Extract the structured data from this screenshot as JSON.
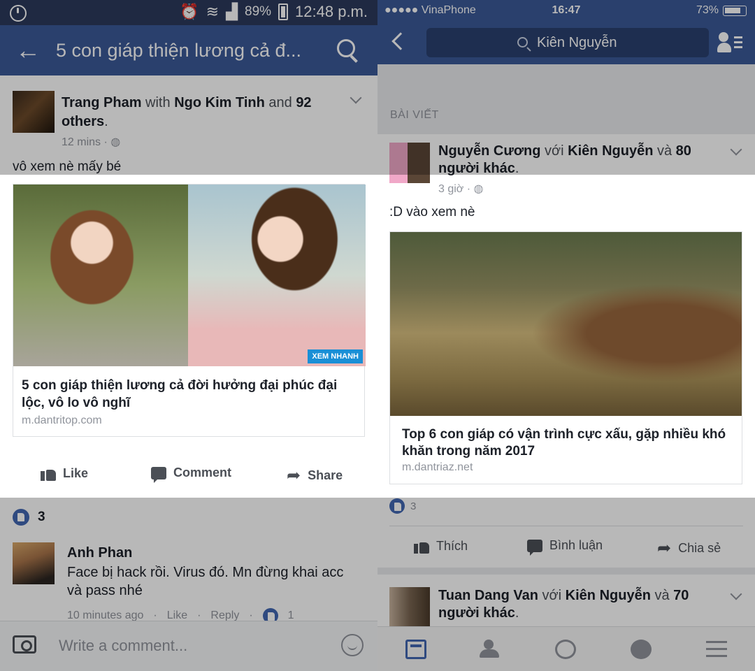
{
  "left": {
    "status": {
      "battery": "89%",
      "time": "12:48 p.m."
    },
    "appbar": {
      "title": "5 con giáp thiện lương cả đ..."
    },
    "post": {
      "author": "Trang Pham",
      "with_word": "with",
      "tagged": "Ngo Kim Tinh",
      "and_word": "and",
      "others_count": "92",
      "others_word": "others",
      "time": "12 mins",
      "message": "vô xem nè mấy bé",
      "link": {
        "badge": "XEM NHANH",
        "title": "5 con giáp thiện lương cả đời hưởng đại phúc đại lộc, vô lo vô nghĩ",
        "url": "m.dantritop.com"
      },
      "actions": {
        "like": "Like",
        "comment": "Comment",
        "share": "Share"
      },
      "likes_count": "3"
    },
    "comment": {
      "author": "Anh Phan",
      "text": "Face bị hack rồi. Virus đó. Mn đừng khai acc và pass nhé",
      "time": "10 minutes ago",
      "like": "Like",
      "reply": "Reply",
      "like_count": "1"
    },
    "composer": {
      "placeholder": "Write a comment..."
    }
  },
  "right": {
    "status": {
      "carrier": "●●●●● VinaPhone",
      "time": "16:47",
      "battery": "73%"
    },
    "search": {
      "query": "Kiên Nguyễn"
    },
    "section_label": "BÀI VIẾT",
    "post": {
      "author": "Nguyễn Cương",
      "with_word": "với",
      "tagged": "Kiên Nguyễn",
      "and_word": "và",
      "others_count": "80",
      "others_word": "người khác",
      "time": "3 giờ",
      "message": ":D vào xem nè",
      "link": {
        "title": "Top 6 con giáp có vận trình cực xấu, gặp nhiều khó khăn trong năm 2017",
        "url": "m.dantriaz.net"
      },
      "likes_count": "3",
      "actions": {
        "like": "Thích",
        "comment": "Bình luận",
        "share": "Chia sẻ"
      }
    },
    "post2": {
      "author": "Tuan Dang Van",
      "with_word": "với",
      "tagged": "Kiên Nguyễn",
      "and_word": "và",
      "others_count": "70",
      "others_word": "người khác"
    },
    "tabs": [
      "news-feed-icon",
      "friends-icon",
      "messenger-icon",
      "globe-icon",
      "menu-icon"
    ]
  }
}
